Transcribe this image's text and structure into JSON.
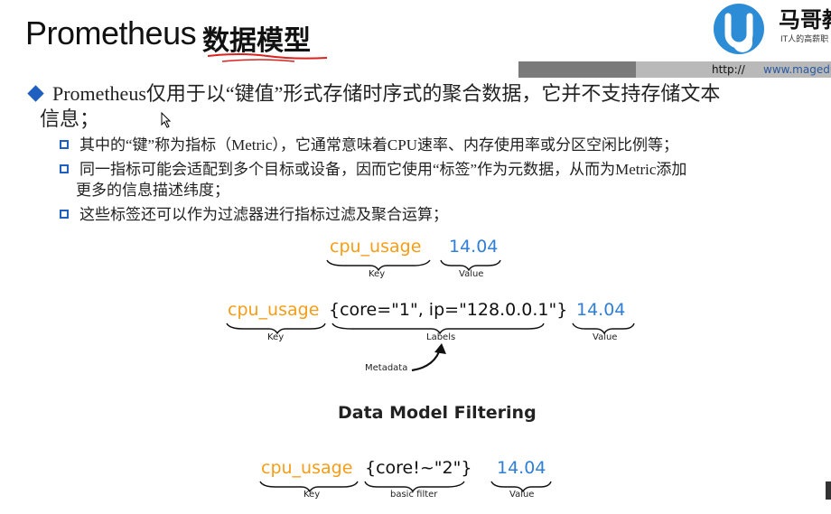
{
  "title": {
    "main": "Prometheus",
    "cn": "数据模型"
  },
  "brand": {
    "name": "马哥教",
    "sub": "IT人的高薪职",
    "http": "http://",
    "url": "www.magedu"
  },
  "bullets": {
    "main_line1": "Prometheus仅用于以“键值”形式存储时序式的聚合数据，它并不支持存储文本",
    "main_line2": "信息；",
    "sub1": "其中的“键”称为指标（Metric），它通常意味着CPU速率、内存使用率或分区空闲比例等；",
    "sub2_line1": "同一指标可能会适配到多个目标或设备，因而它使用“标签”作为元数据，从而为Metric添加",
    "sub2_line2": "更多的信息描述纬度；",
    "sub3": "这些标签还可以作为过滤器进行指标过滤及聚合运算；"
  },
  "diagram": {
    "row1": {
      "key": "cpu_usage",
      "value": "14.04",
      "key_caption": "Key",
      "value_caption": "Value"
    },
    "row2": {
      "key": "cpu_usage",
      "labels": "{core=\"1\", ip=\"128.0.0.1\"}",
      "value": "14.04",
      "key_caption": "Key",
      "labels_caption": "Labels",
      "value_caption": "Value",
      "metadata_caption": "Metadata"
    },
    "filter_title": "Data Model Filtering",
    "row3": {
      "key": "cpu_usage",
      "filter": "{core!~\"2\"}",
      "value": "14.04",
      "key_caption": "Key",
      "filter_caption": "basic filter",
      "value_caption": "Value"
    }
  },
  "colors": {
    "accent": "#1f5fbf",
    "key": "#f59d16",
    "value": "#2f7fd6",
    "underline": "#d9231e"
  }
}
